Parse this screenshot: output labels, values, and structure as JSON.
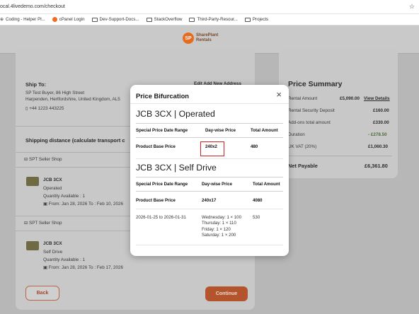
{
  "browser": {
    "url": "ocal.4livedemo.com/checkout",
    "bookmarks": [
      "Coding - Helper Pl...",
      "cPanel Login",
      "Dev-Support-Docs...",
      "StackOverflow",
      "Third-Party-Resour...",
      "Projects"
    ]
  },
  "brand": {
    "logo_line1": "SharePlant",
    "logo_line2": "Rentals",
    "logo_mark": "SP"
  },
  "ship_to": {
    "title": "Ship To:",
    "address1": "SP Test Buyer, 86 High Street",
    "address2": "Harpenden, Hertfordshire, United Kingdom, AL5",
    "phone": "+44 1223 443225",
    "links": "Edit   Add New Address"
  },
  "shipping": {
    "title": "Shipping distance (calculate transport c",
    "groups": [
      {
        "shop": "SPT Seller Shop",
        "item": "JCB 3CX",
        "mode": "Operated",
        "qty": "Quantity Available : 1",
        "dates": "From: Jan 28, 2026 To : Feb 10, 2026"
      },
      {
        "shop": "SPT Seller Shop",
        "item": "JCB 3CX",
        "mode": "Self Drive",
        "qty": "Quantity Available : 1",
        "dates": "From: Jan 28, 2026 To : Feb 17, 2026"
      }
    ]
  },
  "summary": {
    "title": "Price Summary",
    "rows": [
      {
        "label": "Rental Amount",
        "value": "£5,090.00",
        "link": "View Details"
      },
      {
        "label": "Rental Security Deposit",
        "value": "£160.00"
      },
      {
        "label": "Add-ons total amount",
        "value": "£330.00"
      },
      {
        "label": "Duration",
        "value": "- £278.50"
      },
      {
        "label": "UK VAT (20%)",
        "value": "£1,060.30"
      }
    ],
    "total_label": "Net Payable",
    "total_value": "£6,361.80"
  },
  "buttons": {
    "back": "Back",
    "continue": "Continue"
  },
  "modal": {
    "title": "Price Bifurcation",
    "close": "×",
    "sections": [
      {
        "title": "JCB 3CX | Operated",
        "headers": [
          "Special Price Date Range",
          "Day-wise Price",
          "Total Amount"
        ],
        "rows": [
          {
            "c1": "Product Base Price",
            "c2": "240x2",
            "c3": "480"
          }
        ]
      },
      {
        "title": "JCB 3CX | Self Drive",
        "headers": [
          "Special Price Date Range",
          "Day-wise Price",
          "Total Amount"
        ],
        "rows": [
          {
            "c1": "Product Base Price",
            "c2": "240x17",
            "c3": "4080"
          },
          {
            "c1": "2026-01-25 to 2026-01-31",
            "c2_lines": [
              "Wednesday: 1 × 100",
              "Thursday: 1 × 110",
              "Friday: 1 × 120",
              "Saturday: 1 × 200"
            ],
            "c3": "530"
          }
        ]
      }
    ]
  }
}
